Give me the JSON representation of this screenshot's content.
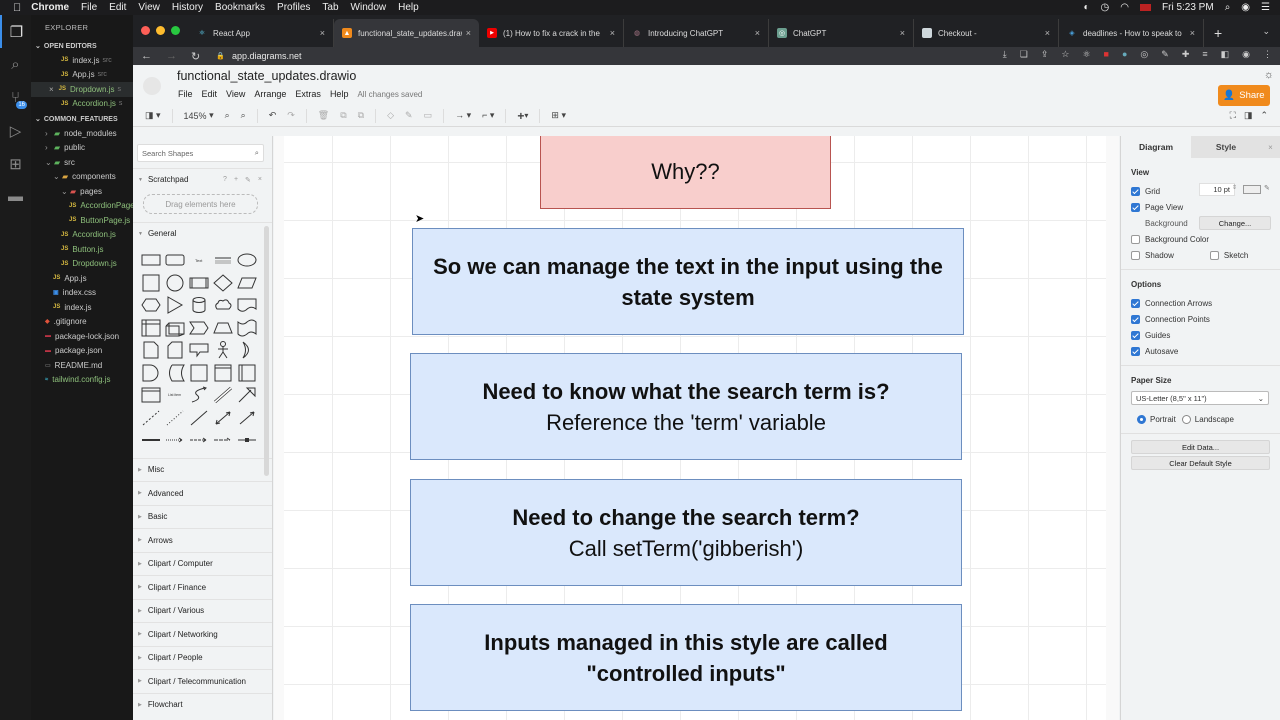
{
  "menubar": {
    "app": "Chrome",
    "items": [
      "File",
      "Edit",
      "View",
      "History",
      "Bookmarks",
      "Profiles",
      "Tab",
      "Window",
      "Help"
    ],
    "clock": "Fri 5:23 PM"
  },
  "vscode": {
    "explorer_title": "EXPLORER",
    "open_editors_title": "OPEN EDITORS",
    "open_editors": [
      {
        "name": "index.js",
        "hint": "src"
      },
      {
        "name": "App.js",
        "hint": "src"
      },
      {
        "name": "Dropdown.js",
        "hint": "s"
      },
      {
        "name": "Accordion.js",
        "hint": "s"
      }
    ],
    "project_title": "COMMON_FEATURES",
    "scm_badge": "16",
    "tree": [
      {
        "name": "node_modules",
        "type": "folder",
        "depth": 1
      },
      {
        "name": "public",
        "type": "folder",
        "depth": 1
      },
      {
        "name": "src",
        "type": "folder",
        "depth": 1
      },
      {
        "name": "components",
        "type": "folder",
        "depth": 2
      },
      {
        "name": "pages",
        "type": "folder",
        "depth": 3
      },
      {
        "name": "AccordionPage.js",
        "type": "js",
        "depth": 4
      },
      {
        "name": "ButtonPage.js",
        "type": "js",
        "depth": 4
      },
      {
        "name": "Accordion.js",
        "type": "js",
        "depth": 3
      },
      {
        "name": "Button.js",
        "type": "js",
        "depth": 3
      },
      {
        "name": "Dropdown.js",
        "type": "js",
        "depth": 3
      },
      {
        "name": "App.js",
        "type": "js",
        "depth": 2
      },
      {
        "name": "index.css",
        "type": "css",
        "depth": 2
      },
      {
        "name": "index.js",
        "type": "js",
        "depth": 2
      },
      {
        "name": ".gitignore",
        "type": "git",
        "depth": 1
      },
      {
        "name": "package-lock.json",
        "type": "json",
        "depth": 1
      },
      {
        "name": "package.json",
        "type": "json",
        "depth": 1
      },
      {
        "name": "README.md",
        "type": "md",
        "depth": 1
      },
      {
        "name": "tailwind.config.js",
        "type": "tw",
        "depth": 1
      }
    ]
  },
  "browser": {
    "tabs": [
      {
        "title": "React App",
        "active": false
      },
      {
        "title": "functional_state_updates.drawio",
        "active": true
      },
      {
        "title": "(1) How to fix a crack in the",
        "active": false
      },
      {
        "title": "Introducing ChatGPT",
        "active": false
      },
      {
        "title": "ChatGPT",
        "active": false
      },
      {
        "title": "Checkout -",
        "active": false
      },
      {
        "title": "deadlines - How to speak to",
        "active": false
      }
    ],
    "url": "app.diagrams.net"
  },
  "drawio": {
    "filename": "functional_state_updates.drawio",
    "menu": [
      "File",
      "Edit",
      "View",
      "Arrange",
      "Extras",
      "Help"
    ],
    "save_status": "All changes saved",
    "share_label": "Share",
    "zoom": "145%",
    "search_placeholder": "Search Shapes",
    "scratchpad": {
      "title": "Scratchpad",
      "drop_hint": "Drag elements here"
    },
    "general_title": "General",
    "categories": [
      "Misc",
      "Advanced",
      "Basic",
      "Arrows",
      "Clipart / Computer",
      "Clipart / Finance",
      "Clipart / Various",
      "Clipart / Networking",
      "Clipart / People",
      "Clipart / Telecommunication",
      "Flowchart"
    ],
    "canvas_boxes": [
      {
        "bold": "",
        "normal": "Why??",
        "style": "red"
      },
      {
        "bold": "So we can manage the text in the input using the state system",
        "normal": "",
        "style": "blue"
      },
      {
        "bold": "Need to know what the search term is?",
        "normal": "Reference the 'term' variable",
        "style": "blue"
      },
      {
        "bold": "Need to change the search term?",
        "normal": "Call setTerm('gibberish')",
        "style": "blue"
      },
      {
        "bold": "Inputs managed in this style are called \"controlled inputs\"",
        "normal": "",
        "style": "blue"
      }
    ],
    "format": {
      "tabs": [
        "Diagram",
        "Style"
      ],
      "view_title": "View",
      "grid": {
        "label": "Grid",
        "checked": true,
        "size": "10 pt"
      },
      "page_view": {
        "label": "Page View",
        "checked": true
      },
      "background_label": "Background",
      "change_button": "Change...",
      "background_color": {
        "label": "Background Color",
        "checked": false
      },
      "shadow": {
        "label": "Shadow",
        "checked": false
      },
      "sketch": {
        "label": "Sketch",
        "checked": false
      },
      "options_title": "Options",
      "options": [
        {
          "label": "Connection Arrows",
          "checked": true
        },
        {
          "label": "Connection Points",
          "checked": true
        },
        {
          "label": "Guides",
          "checked": true
        },
        {
          "label": "Autosave",
          "checked": true
        }
      ],
      "paper_title": "Paper Size",
      "paper_size": "US-Letter (8,5\" x 11\")",
      "orientation": {
        "portrait": "Portrait",
        "landscape": "Landscape",
        "selected": "portrait"
      },
      "edit_data": "Edit Data...",
      "clear_style": "Clear Default Style"
    }
  },
  "colors": {
    "share": "#f08a1c",
    "box_blue": "#dae8fc",
    "box_red": "#f8cecc",
    "checkbox": "#2f77d3"
  }
}
